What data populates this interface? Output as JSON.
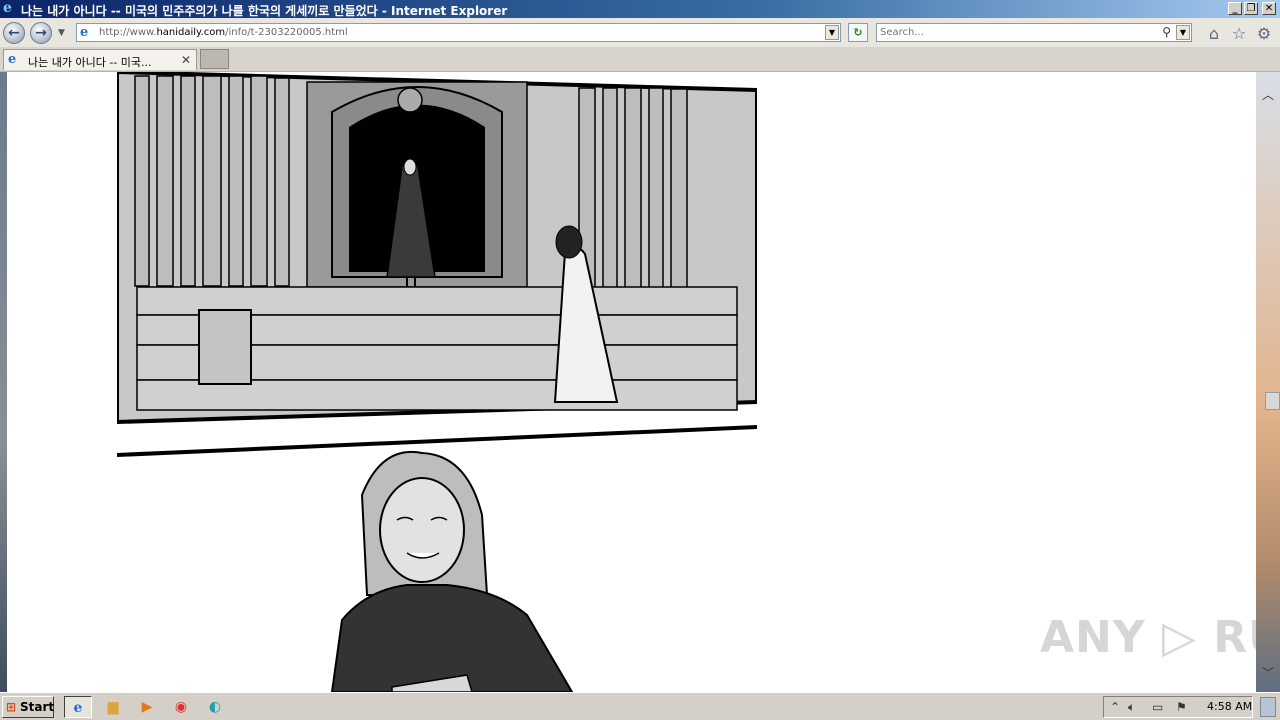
{
  "window": {
    "title": "나는 내가 아니다 -- 미국의 민주주의가 나를 한국의 게세끼로 만들었다 - Internet Explorer",
    "controls": {
      "minimize": "_",
      "restore": "❐",
      "close": "✕"
    }
  },
  "address_bar": {
    "url_prefix": "http://www.",
    "url_domain": "hanidaily.com",
    "url_path": "/info/t-2303220005.html",
    "page_icon": "ie-page-icon"
  },
  "search": {
    "placeholder": "Search..."
  },
  "toolbar": {
    "home_icon": "home-icon",
    "favorites_icon": "star-icon",
    "tools_icon": "gear-icon"
  },
  "tabs": [
    {
      "label": "나는 내가 아니다 -- 미국...",
      "active": true
    }
  ],
  "watermark": {
    "text": "ANY ▷ RUN"
  },
  "taskbar": {
    "start_label": "Start",
    "apps": [
      "internet-explorer",
      "file-explorer",
      "media-player",
      "chrome",
      "edge"
    ],
    "clock": "4:58 AM"
  }
}
